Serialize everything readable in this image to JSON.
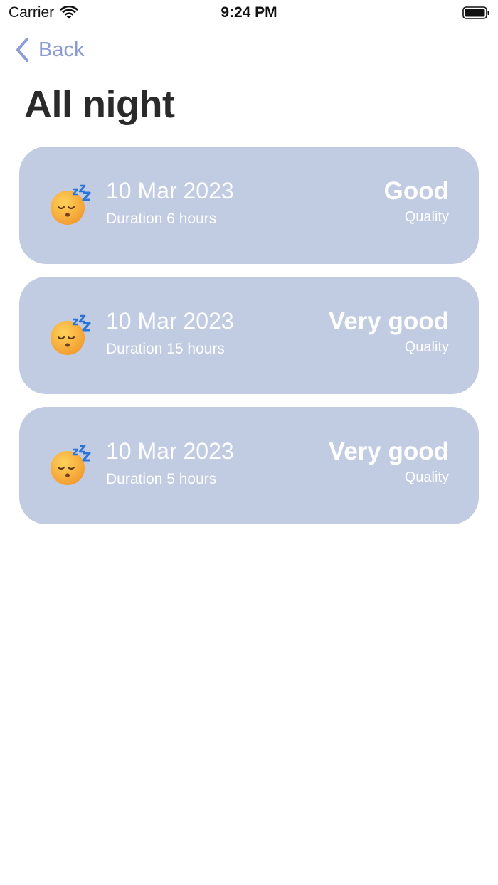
{
  "status_bar": {
    "carrier": "Carrier",
    "time": "9:24 PM",
    "wifi_icon": "wifi-icon",
    "battery_icon": "battery-full-icon"
  },
  "nav": {
    "back_label": "Back",
    "back_icon": "chevron-left-icon",
    "accent_color": "#8a9bd6"
  },
  "page": {
    "title": "All night"
  },
  "card_style": {
    "background": "#c1cbe2",
    "text_color": "#ffffff",
    "emoji": "sleeping-face-icon"
  },
  "entries": [
    {
      "date": "10 Mar 2023",
      "duration": "Duration 6 hours",
      "quality": "Good",
      "quality_label": "Quality"
    },
    {
      "date": "10 Mar 2023",
      "duration": "Duration 15 hours",
      "quality": "Very good",
      "quality_label": "Quality"
    },
    {
      "date": "10 Mar 2023",
      "duration": "Duration 5 hours",
      "quality": "Very good",
      "quality_label": "Quality"
    }
  ]
}
